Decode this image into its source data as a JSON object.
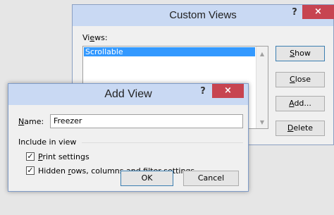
{
  "custom_views": {
    "title": "Custom Views",
    "help": "?",
    "close": "×",
    "views_label_pre": "Vi",
    "views_label_u": "e",
    "views_label_post": "ws:",
    "list_items": [
      "Scrollable"
    ],
    "buttons": {
      "show": {
        "u": "S",
        "rest": "how"
      },
      "close": {
        "u": "C",
        "rest": "lose"
      },
      "add": {
        "u": "A",
        "rest": "dd..."
      },
      "delete": {
        "u": "D",
        "rest": "elete"
      }
    }
  },
  "add_view": {
    "title": "Add View",
    "help": "?",
    "close": "×",
    "name_label_u": "N",
    "name_label_rest": "ame:",
    "name_value": "Freezer",
    "group_label": "Include in view",
    "option_print_u": "P",
    "option_print_rest": "rint settings",
    "option_print_checked": true,
    "option_hidden_pre": "Hidden ",
    "option_hidden_u": "r",
    "option_hidden_post": "ows, columns and filter settings",
    "option_hidden_checked": true,
    "ok_label": "OK",
    "cancel_label": "Cancel"
  },
  "colors": {
    "titlebar": "#c9d9f3",
    "close_button": "#c74450",
    "selection": "#3399ff"
  }
}
